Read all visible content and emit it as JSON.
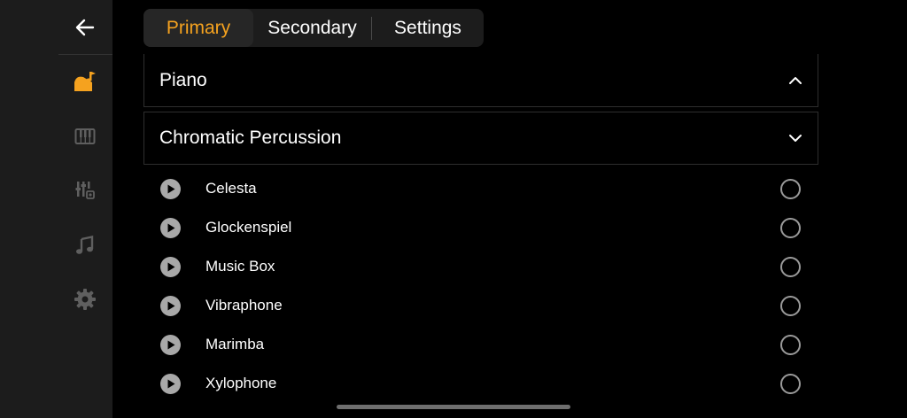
{
  "sidebar": {
    "items": [
      {
        "icon": "back-arrow-icon"
      },
      {
        "icon": "instrument-icon",
        "active": true
      },
      {
        "icon": "keyboard-icon"
      },
      {
        "icon": "mixer-icon"
      },
      {
        "icon": "music-note-icon"
      },
      {
        "icon": "gear-icon"
      }
    ],
    "active_color": "#f5a21f",
    "inactive_color": "#5f5f5f"
  },
  "tabs": [
    {
      "label": "Primary",
      "active": true
    },
    {
      "label": "Secondary",
      "active": false
    },
    {
      "label": "Settings",
      "active": false
    }
  ],
  "sections": [
    {
      "title": "Piano",
      "state": "collapsed",
      "chevron": "chevron-up-icon"
    },
    {
      "title": "Chromatic Percussion",
      "state": "expanded",
      "chevron": "chevron-down-icon"
    }
  ],
  "instruments": [
    {
      "name": "Celesta",
      "selected": false
    },
    {
      "name": "Glockenspiel",
      "selected": false
    },
    {
      "name": "Music Box",
      "selected": false
    },
    {
      "name": "Vibraphone",
      "selected": false
    },
    {
      "name": "Marimba",
      "selected": false
    },
    {
      "name": "Xylophone",
      "selected": false
    }
  ]
}
